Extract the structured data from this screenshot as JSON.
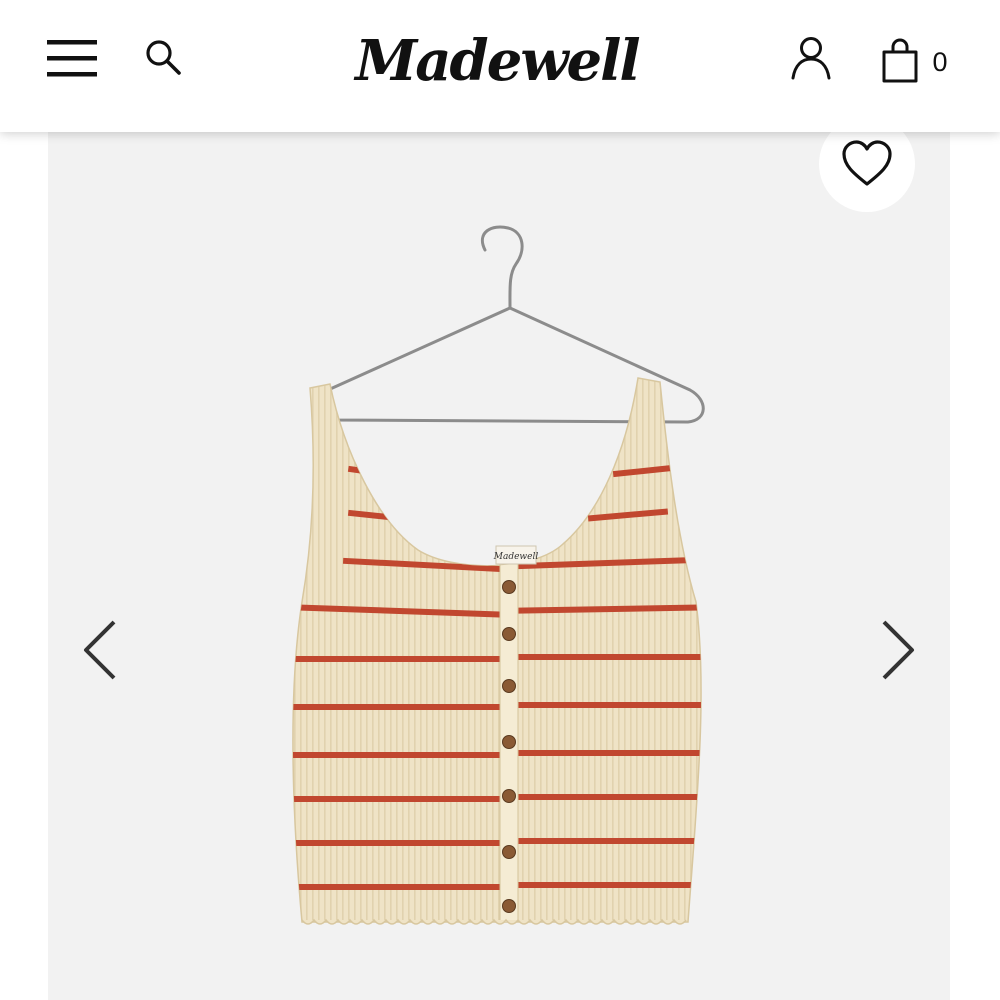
{
  "header": {
    "brand": "Madewell",
    "bag_count": "0",
    "icons": {
      "menu": "hamburger-menu-icon",
      "search": "search-icon",
      "account": "account-icon",
      "bag": "shopping-bag-icon"
    }
  },
  "product": {
    "image": "striped-button-front-sweater-tank-on-hanger",
    "neck_label_text": "Madewell",
    "colors": {
      "knit": "#efe3c6",
      "stripe": "#c1472f",
      "background": "#f2f2f2",
      "button": "#8a5a35"
    }
  },
  "gallery": {
    "favorite_icon": "heart-outline-icon",
    "prev_icon": "chevron-left-icon",
    "next_icon": "chevron-right-icon"
  }
}
